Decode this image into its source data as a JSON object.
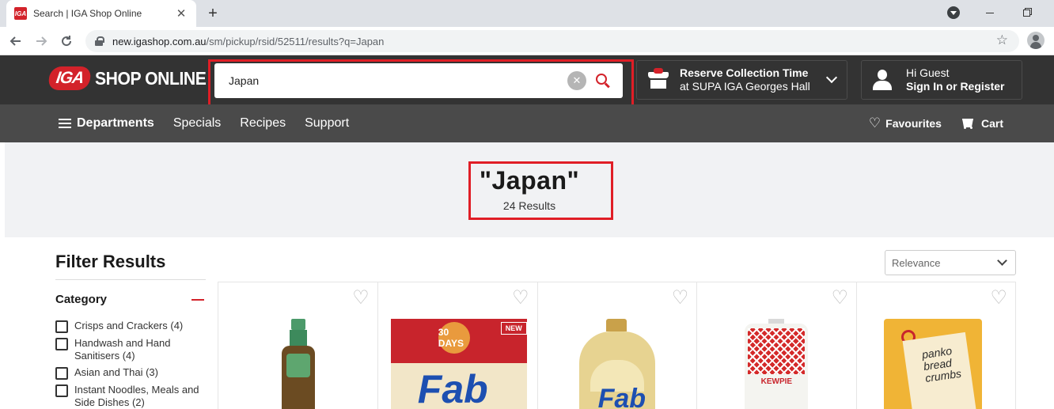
{
  "browser": {
    "tab_title": "Search | IGA Shop Online",
    "favicon_text": "IGA",
    "close_glyph": "✕",
    "newtab_glyph": "+",
    "url_host": "new.igashop.com.au",
    "url_path": "/sm/pickup/rsid/52511/results?q=Japan",
    "icons": [
      "back-icon",
      "forward-icon",
      "reload-icon",
      "lock-icon",
      "star-icon",
      "profile-icon"
    ]
  },
  "header": {
    "logo_mark": "IGA",
    "logo_text": "SHOP ONLINE",
    "search": {
      "value": "Japan",
      "placeholder": ""
    },
    "clear_glyph": "✕",
    "reserve": {
      "title": "Reserve Collection Time",
      "subtitle": "at SUPA IGA Georges Hall"
    },
    "account": {
      "greeting": "Hi Guest",
      "link": "Sign In or Register"
    }
  },
  "nav": {
    "items": [
      {
        "label": "Departments"
      },
      {
        "label": "Specials"
      },
      {
        "label": "Recipes"
      },
      {
        "label": "Support"
      }
    ],
    "favourites": "Favourites",
    "cart": "Cart",
    "heart_glyph": "♡"
  },
  "results": {
    "query": "\"Japan\"",
    "count": "24 Results"
  },
  "filters": {
    "title": "Filter Results",
    "category_title": "Category",
    "categories": [
      {
        "label": "Crisps and Crackers (4)"
      },
      {
        "label": "Handwash and Hand Sanitisers (4)"
      },
      {
        "label": "Asian and Thai (3)"
      },
      {
        "label": "Instant Noodles, Meals and Side Dishes (2)"
      }
    ]
  },
  "sort": {
    "selected": "Relevance"
  },
  "products": {
    "fav_glyph": "♡",
    "items": [
      {
        "image": "dressing-bottle"
      },
      {
        "image": "fab-laundry-powder",
        "badge": "NEW",
        "days_badge": "30 DAYS",
        "brand": "Fab"
      },
      {
        "image": "fab-laundry-liquid",
        "brand": "Fab"
      },
      {
        "image": "kewpie-mayonnaise",
        "brand": "KEWPIE"
      },
      {
        "image": "panko-bread-crumbs",
        "brand": "panko bread crumbs"
      }
    ]
  },
  "colors": {
    "brand_red": "#d3222a",
    "header_bg": "#333333",
    "nav_bg": "#4a4a4a",
    "banner_bg": "#f1f2f4",
    "highlight": "#e01e26"
  }
}
